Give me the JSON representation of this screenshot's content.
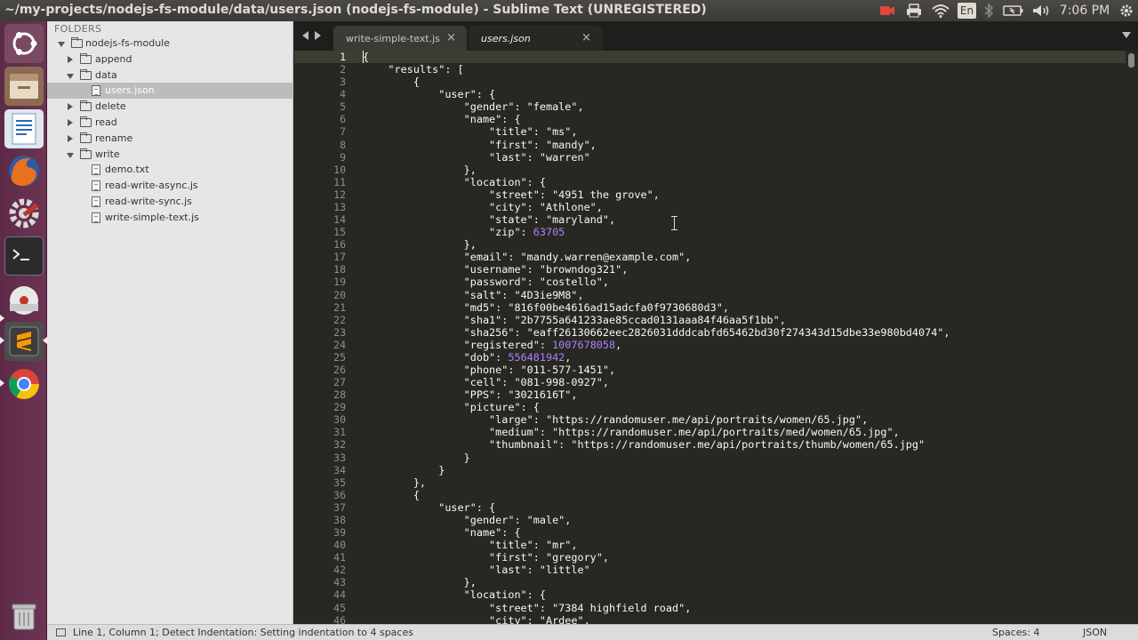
{
  "window": {
    "title": "~/my-projects/nodejs-fs-module/data/users.json (nodejs-fs-module) - Sublime Text (UNREGISTERED)"
  },
  "system_tray": {
    "icons": [
      "camera-icon",
      "printer-icon",
      "wifi-icon",
      "keyboard-layout-icon",
      "bluetooth-icon",
      "battery-icon",
      "volume-icon",
      "settings-icon"
    ],
    "keyboard_layout": "En",
    "clock": "7:06 PM"
  },
  "launcher": {
    "icons": [
      "ubuntu-dash-icon",
      "files-icon",
      "libreoffice-writer-icon",
      "firefox-icon",
      "system-settings-icon",
      "terminal-icon",
      "disk-utility-icon",
      "sublime-text-icon",
      "chrome-icon",
      "trash-icon"
    ]
  },
  "sidebar": {
    "header": "FOLDERS",
    "root": "nodejs-fs-module",
    "items": [
      {
        "label": "append",
        "type": "folder",
        "expanded": false
      },
      {
        "label": "data",
        "type": "folder",
        "expanded": true
      },
      {
        "label": "users.json",
        "type": "file",
        "selected": true
      },
      {
        "label": "delete",
        "type": "folder",
        "expanded": false
      },
      {
        "label": "read",
        "type": "folder",
        "expanded": false
      },
      {
        "label": "rename",
        "type": "folder",
        "expanded": false
      },
      {
        "label": "write",
        "type": "folder",
        "expanded": true
      },
      {
        "label": "demo.txt",
        "type": "file"
      },
      {
        "label": "read-write-async.js",
        "type": "file"
      },
      {
        "label": "read-write-sync.js",
        "type": "file"
      },
      {
        "label": "write-simple-text.js",
        "type": "file"
      }
    ]
  },
  "tabs": [
    {
      "label": "write-simple-text.js",
      "close": "×"
    },
    {
      "label": "users.json",
      "close": "×",
      "active": true
    }
  ],
  "editor": {
    "current_line": 1,
    "lines": [
      "{",
      "    \"results\": [",
      "        {",
      "            \"user\": {",
      "                \"gender\": \"female\",",
      "                \"name\": {",
      "                    \"title\": \"ms\",",
      "                    \"first\": \"mandy\",",
      "                    \"last\": \"warren\"",
      "                },",
      "                \"location\": {",
      "                    \"street\": \"4951 the grove\",",
      "                    \"city\": \"Athlone\",",
      "                    \"state\": \"maryland\",",
      "                    \"zip\": 63705",
      "                },",
      "                \"email\": \"mandy.warren@example.com\",",
      "                \"username\": \"browndog321\",",
      "                \"password\": \"costello\",",
      "                \"salt\": \"4D3ie9M8\",",
      "                \"md5\": \"816f00be4616ad15adcfa0f9730680d3\",",
      "                \"sha1\": \"2b7755a641233ae85ccad0131aaa84f46aa5f1bb\",",
      "                \"sha256\": \"eaff26130662eec2826031dddcabfd65462bd30f274343d15dbe33e980bd4074\",",
      "                \"registered\": 1007678058,",
      "                \"dob\": 556481942,",
      "                \"phone\": \"011-577-1451\",",
      "                \"cell\": \"081-998-0927\",",
      "                \"PPS\": \"3021616T\",",
      "                \"picture\": {",
      "                    \"large\": \"https://randomuser.me/api/portraits/women/65.jpg\",",
      "                    \"medium\": \"https://randomuser.me/api/portraits/med/women/65.jpg\",",
      "                    \"thumbnail\": \"https://randomuser.me/api/portraits/thumb/women/65.jpg\"",
      "                }",
      "            }",
      "        },",
      "        {",
      "            \"user\": {",
      "                \"gender\": \"male\",",
      "                \"name\": {",
      "                    \"title\": \"mr\",",
      "                    \"first\": \"gregory\",",
      "                    \"last\": \"little\"",
      "                },",
      "                \"location\": {",
      "                    \"street\": \"7384 highfield road\",",
      "                    \"city\": \"Ardee\","
    ]
  },
  "statusbar": {
    "message": "Line 1, Column 1; Detect Indentation: Setting indentation to 4 spaces",
    "spaces": "Spaces: 4",
    "syntax": "JSON"
  },
  "colors": {
    "editor_bg": "#272822",
    "text": "#f8f8f2",
    "number": "#ae81ff",
    "launcher": "#5d2a46",
    "sidebar_bg": "#e6e6e6"
  }
}
